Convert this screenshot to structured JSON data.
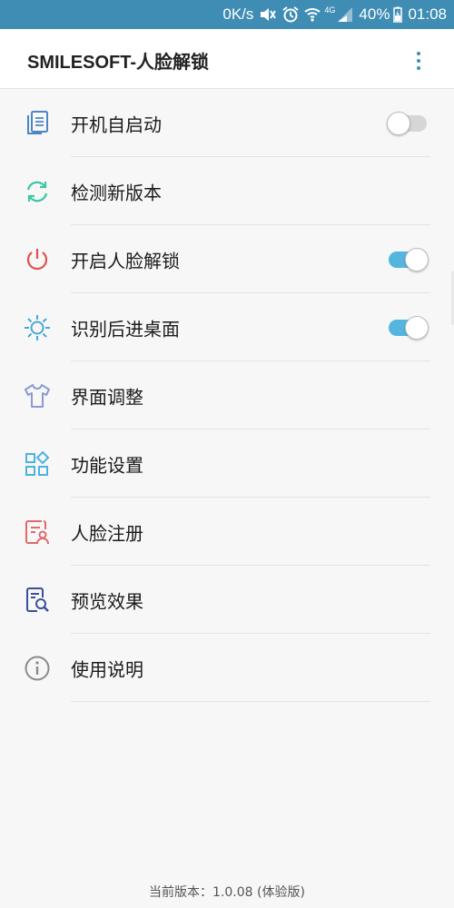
{
  "status_bar": {
    "net_speed": "0K/s",
    "network": "4G",
    "battery": "40%",
    "time": "01:08"
  },
  "app_bar": {
    "title": "SMILESOFT-人脸解锁"
  },
  "items": [
    {
      "label": "开机自启动",
      "icon": "document-icon",
      "color": "#4a86c8",
      "toggle": false
    },
    {
      "label": "检测新版本",
      "icon": "refresh-icon",
      "color": "#3cc7a5"
    },
    {
      "label": "开启人脸解锁",
      "icon": "power-icon",
      "color": "#e35050",
      "toggle": true
    },
    {
      "label": "识别后进桌面",
      "icon": "sun-icon",
      "color": "#4aa6d8",
      "toggle": true
    },
    {
      "label": "界面调整",
      "icon": "shirt-icon",
      "color": "#8c9ad4"
    },
    {
      "label": "功能设置",
      "icon": "grid-icon",
      "color": "#4ab4e0"
    },
    {
      "label": "人脸注册",
      "icon": "id-card-icon",
      "color": "#e06a6a"
    },
    {
      "label": "预览效果",
      "icon": "document-search-icon",
      "color": "#3a4f9c"
    },
    {
      "label": "使用说明",
      "icon": "info-icon",
      "color": "#8a8a8a"
    }
  ],
  "footer": {
    "version": "当前版本：1.0.08 (体验版)"
  }
}
